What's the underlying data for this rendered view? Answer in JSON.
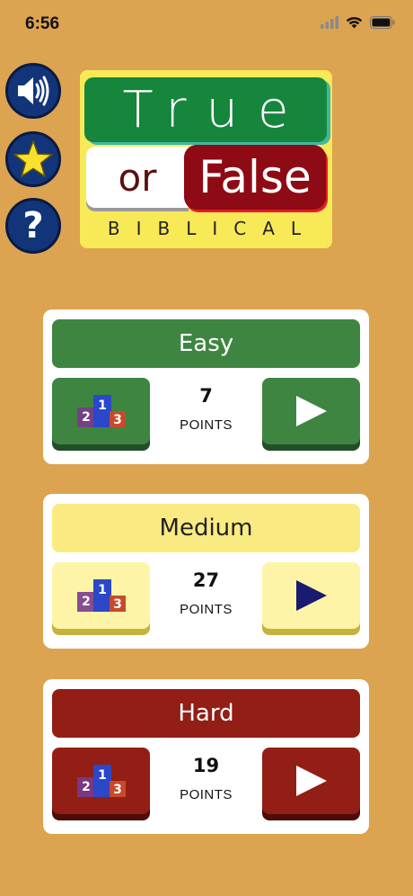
{
  "status_bar": {
    "time": "6:56"
  },
  "logo": {
    "word_true": "True",
    "word_or": "or",
    "word_false": "False",
    "subtitle": "BIBLICAL"
  },
  "side_buttons": [
    {
      "icon": "speaker-icon"
    },
    {
      "icon": "star-icon"
    },
    {
      "icon": "question-icon",
      "glyph": "?"
    }
  ],
  "levels": [
    {
      "title": "Easy",
      "score": "7",
      "score_label": "POINTS",
      "play_color": "#ffffff"
    },
    {
      "title": "Medium",
      "score": "27",
      "score_label": "POINTS",
      "play_color": "#1A1A6E"
    },
    {
      "title": "Hard",
      "score": "19",
      "score_label": "POINTS",
      "play_color": "#ffffff"
    }
  ],
  "podium": {
    "first": "1",
    "second": "2",
    "third": "3"
  },
  "colors": {
    "background": "#DCA350",
    "easy": "#3F8542",
    "medium": "#FAEA82",
    "hard": "#921E16",
    "round_button": "#12357A"
  }
}
